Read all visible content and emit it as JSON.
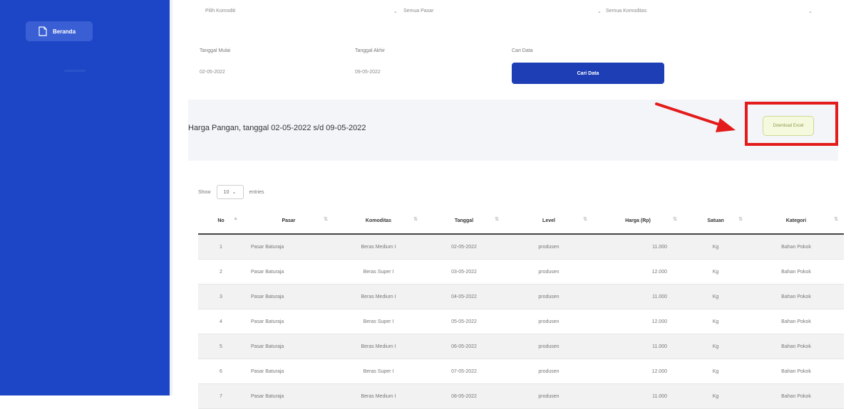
{
  "sidebar": {
    "items": [
      {
        "label": "Beranda",
        "icon": "document-icon"
      }
    ]
  },
  "filters": {
    "pasar": "Pilih Komoditi",
    "komoditi": "Semua Pasar",
    "jenis": "Semua Komoditas"
  },
  "dates": {
    "start_label": "Tanggal Mulai",
    "start_value": "02-05-2022",
    "end_label": "Tanggal Akhir",
    "end_value": "09-05-2022",
    "search_label": "Cari Data",
    "search_button": "Cari Data"
  },
  "result": {
    "title": "Harga Pangan, tanggal 02-05-2022 s/d 09-05-2022",
    "download_button": "Download Excel"
  },
  "table_controls": {
    "show_label": "Show",
    "show_value": "10",
    "entries_label": "entries"
  },
  "table": {
    "headers": [
      "No",
      "Pasar",
      "Komoditas",
      "Tanggal",
      "Level",
      "Harga (Rp)",
      "Satuan",
      "Kategori"
    ],
    "rows": [
      [
        "1",
        "Pasar Baturaja",
        "Beras Medium I",
        "02-05-2022",
        "produsen",
        "11.000",
        "Kg",
        "Bahan Pokok"
      ],
      [
        "2",
        "Pasar Baturaja",
        "Beras Super I",
        "03-05-2022",
        "produsen",
        "12.000",
        "Kg",
        "Bahan Pokok"
      ],
      [
        "3",
        "Pasar Baturaja",
        "Beras Medium I",
        "04-05-2022",
        "produsen",
        "11.000",
        "Kg",
        "Bahan Pokok"
      ],
      [
        "4",
        "Pasar Baturaja",
        "Beras Super I",
        "05-05-2022",
        "produsen",
        "12.000",
        "Kg",
        "Bahan Pokok"
      ],
      [
        "5",
        "Pasar Baturaja",
        "Beras Medium I",
        "06-05-2022",
        "produsen",
        "11.000",
        "Kg",
        "Bahan Pokok"
      ],
      [
        "6",
        "Pasar Baturaja",
        "Beras Super I",
        "07-05-2022",
        "produsen",
        "12.000",
        "Kg",
        "Bahan Pokok"
      ],
      [
        "7",
        "Pasar Baturaja",
        "Beras Medium I",
        "08-05-2022",
        "produsen",
        "11.000",
        "Kg",
        "Bahan Pokok"
      ]
    ]
  },
  "colors": {
    "sidebar": "#1d46c6",
    "primary_button": "#1d3eb5",
    "highlight": "#e31b1b"
  }
}
